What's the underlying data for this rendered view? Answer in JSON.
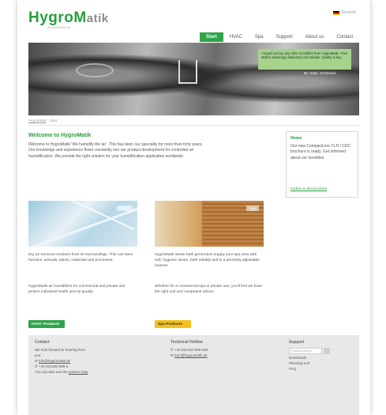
{
  "header": {
    "logo_part1": "HygroM",
    "logo_part2": "atik",
    "tagline": "we humidify the air",
    "language_label": "Deutsch",
    "nav": [
      "Start",
      "HVAC",
      "Spa",
      "Support",
      "About us",
      "Contact"
    ]
  },
  "hero": {
    "quote": "I would not buy any other humidifier than HygroMatik. Their staff is amazingly dedicated and reliable. Quality is key.",
    "signature": "Mr. Nolte, Dortmund"
  },
  "breadcrumb": [
    "HygroMatik",
    "Start"
  ],
  "welcome": {
    "title": "Welcome to HygroMatik",
    "text": "Welcome to HygroMatik 'We humidify the air'. This has been our speciality for more than forty years. Our knowledge and experience flows constantly into our product development for controlled air humidification. We provide the right solution for your humidification application worldwide."
  },
  "news": {
    "title": "News",
    "text": "Our new CompactLine CLH / CDC brochure is ready. Get informed about our novelties.",
    "more": "Further to the brochure"
  },
  "products": {
    "hvac": {
      "tag": "HVAC",
      "text1": "Dry air removes moisture from its surroundings. This can have humans, animals, plants, materials and processes.",
      "text2": "HygroMatik air humidifiers for commercial and private use protect individual health and air quality.",
      "button": "HVAC Products"
    },
    "spa": {
      "tag": "Spa",
      "text1": "HygroMatik steam bath generators supply your spa area with soft, hygienic steam, both reliably and in a precisely adjustable manner.",
      "text2": "Whether for a commercial spa or private use, you'll find we have the right unit and competent advice.",
      "button": "Spa Products"
    }
  },
  "footer": {
    "contact": {
      "title": "Contact",
      "lines": [
        "We look forward to hearing from",
        "you:"
      ],
      "email": "info@hygromatik.de",
      "phone": "+49 (0)4193 895-0",
      "partner_prefix": "You can also use the",
      "partner_link": "partner map"
    },
    "hotline": {
      "title": "Technical Hotline",
      "phone": "+49 (0)4193 895-293",
      "email": "hot-l@hygromatik.de"
    },
    "support": {
      "title": "Support",
      "select_placeholder": "Product series",
      "links": [
        "Downloads",
        "Planning tool",
        "FAQ"
      ]
    }
  },
  "colors": {
    "brand_green": "#2fa44a",
    "spa_yellow": "#f4c21a",
    "footer_bg": "#e8e8e8"
  }
}
